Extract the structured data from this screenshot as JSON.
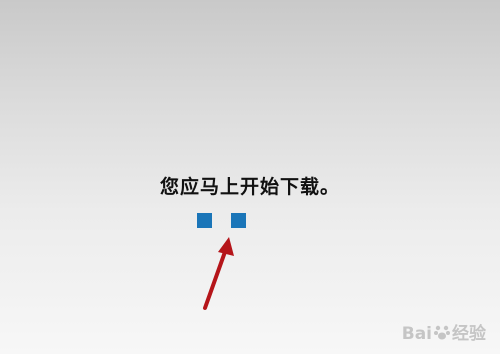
{
  "message": "您应马上开始下载。",
  "watermark": {
    "brand_left": "Bai",
    "brand_right": "经验"
  },
  "colors": {
    "square": "#1a75b8",
    "arrow": "#b5151a",
    "text": "#111111"
  }
}
